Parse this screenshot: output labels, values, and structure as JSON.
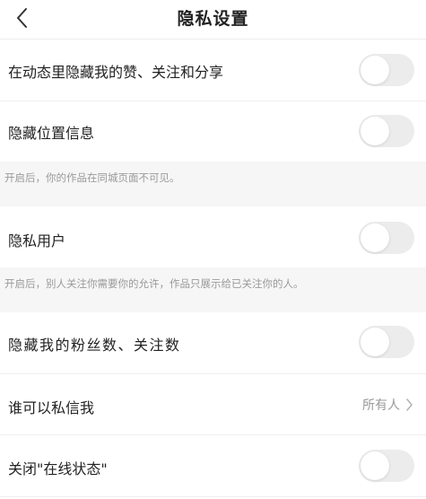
{
  "header": {
    "title": "隐私设置",
    "back_icon": "chevron-left-icon"
  },
  "settings": {
    "hide_activity": {
      "label": "在动态里隐藏我的赞、关注和分享",
      "enabled": false
    },
    "hide_location": {
      "label": "隐藏位置信息",
      "enabled": false
    },
    "hide_location_note": "开启后，你的作品在同城页面不可见。",
    "private_user": {
      "label": "隐私用户",
      "enabled": false
    },
    "private_user_note": "开启后，别人关注你需要你的允许，作品只展示给已关注你的人。",
    "hide_counts": {
      "label": "隐藏我的粉丝数、关注数",
      "enabled": false
    },
    "who_can_message": {
      "label": "谁可以私信我",
      "value": "所有人"
    },
    "close_online_status": {
      "label": "关闭\"在线状态\"",
      "enabled": false
    }
  },
  "colors": {
    "toggle_off": "#ececec",
    "note_band": "#f6f6f6",
    "secondary_text": "#999999"
  }
}
